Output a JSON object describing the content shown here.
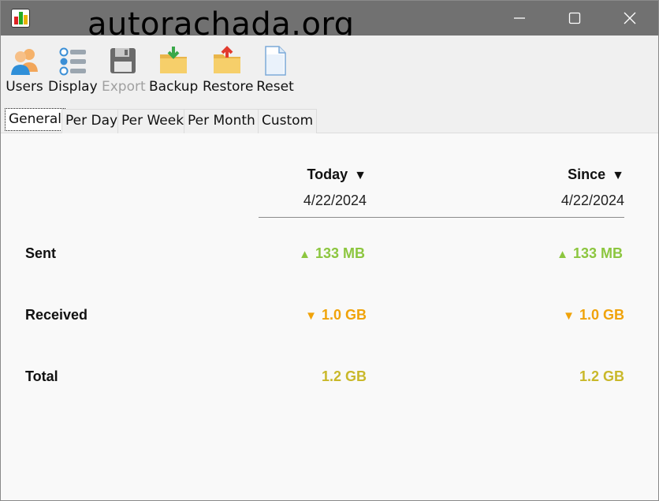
{
  "window": {
    "title": "autorachada.org",
    "icons": {
      "app": "bar-chart-app-icon",
      "minimize": "minimize-icon",
      "maximize": "maximize-icon",
      "close": "close-icon"
    }
  },
  "toolbar": {
    "items": [
      {
        "label": "Users",
        "icon": "users-icon",
        "enabled": true
      },
      {
        "label": "Display",
        "icon": "display-list-icon",
        "enabled": true
      },
      {
        "label": "Export",
        "icon": "floppy-disk-icon",
        "enabled": false
      },
      {
        "label": "Backup",
        "icon": "folder-download-icon",
        "enabled": true
      },
      {
        "label": "Restore",
        "icon": "folder-upload-icon",
        "enabled": true
      },
      {
        "label": "Reset",
        "icon": "blank-document-icon",
        "enabled": true
      }
    ]
  },
  "tabs": [
    {
      "label": "General",
      "active": true
    },
    {
      "label": "Per Day",
      "active": false
    },
    {
      "label": "Per Week",
      "active": false
    },
    {
      "label": "Per Month",
      "active": false
    },
    {
      "label": "Custom",
      "active": false
    }
  ],
  "summary": {
    "columns": [
      {
        "header": "Today",
        "header_icon": "dropdown-triangle-icon",
        "date": "4/22/2024"
      },
      {
        "header": "Since",
        "header_icon": "dropdown-triangle-icon",
        "date": "4/22/2024"
      }
    ],
    "rows": [
      {
        "label": "Sent",
        "direction": "up",
        "today": "133 MB",
        "since": "133 MB"
      },
      {
        "label": "Received",
        "direction": "down",
        "today": "1.0 GB",
        "since": "1.0 GB"
      },
      {
        "label": "Total",
        "direction": "none",
        "today": "1.2 GB",
        "since": "1.2 GB"
      }
    ]
  },
  "colors": {
    "titlebar": "#717171",
    "sent": "#8cc63f",
    "received": "#f0a30a",
    "total": "#c9b82a"
  }
}
